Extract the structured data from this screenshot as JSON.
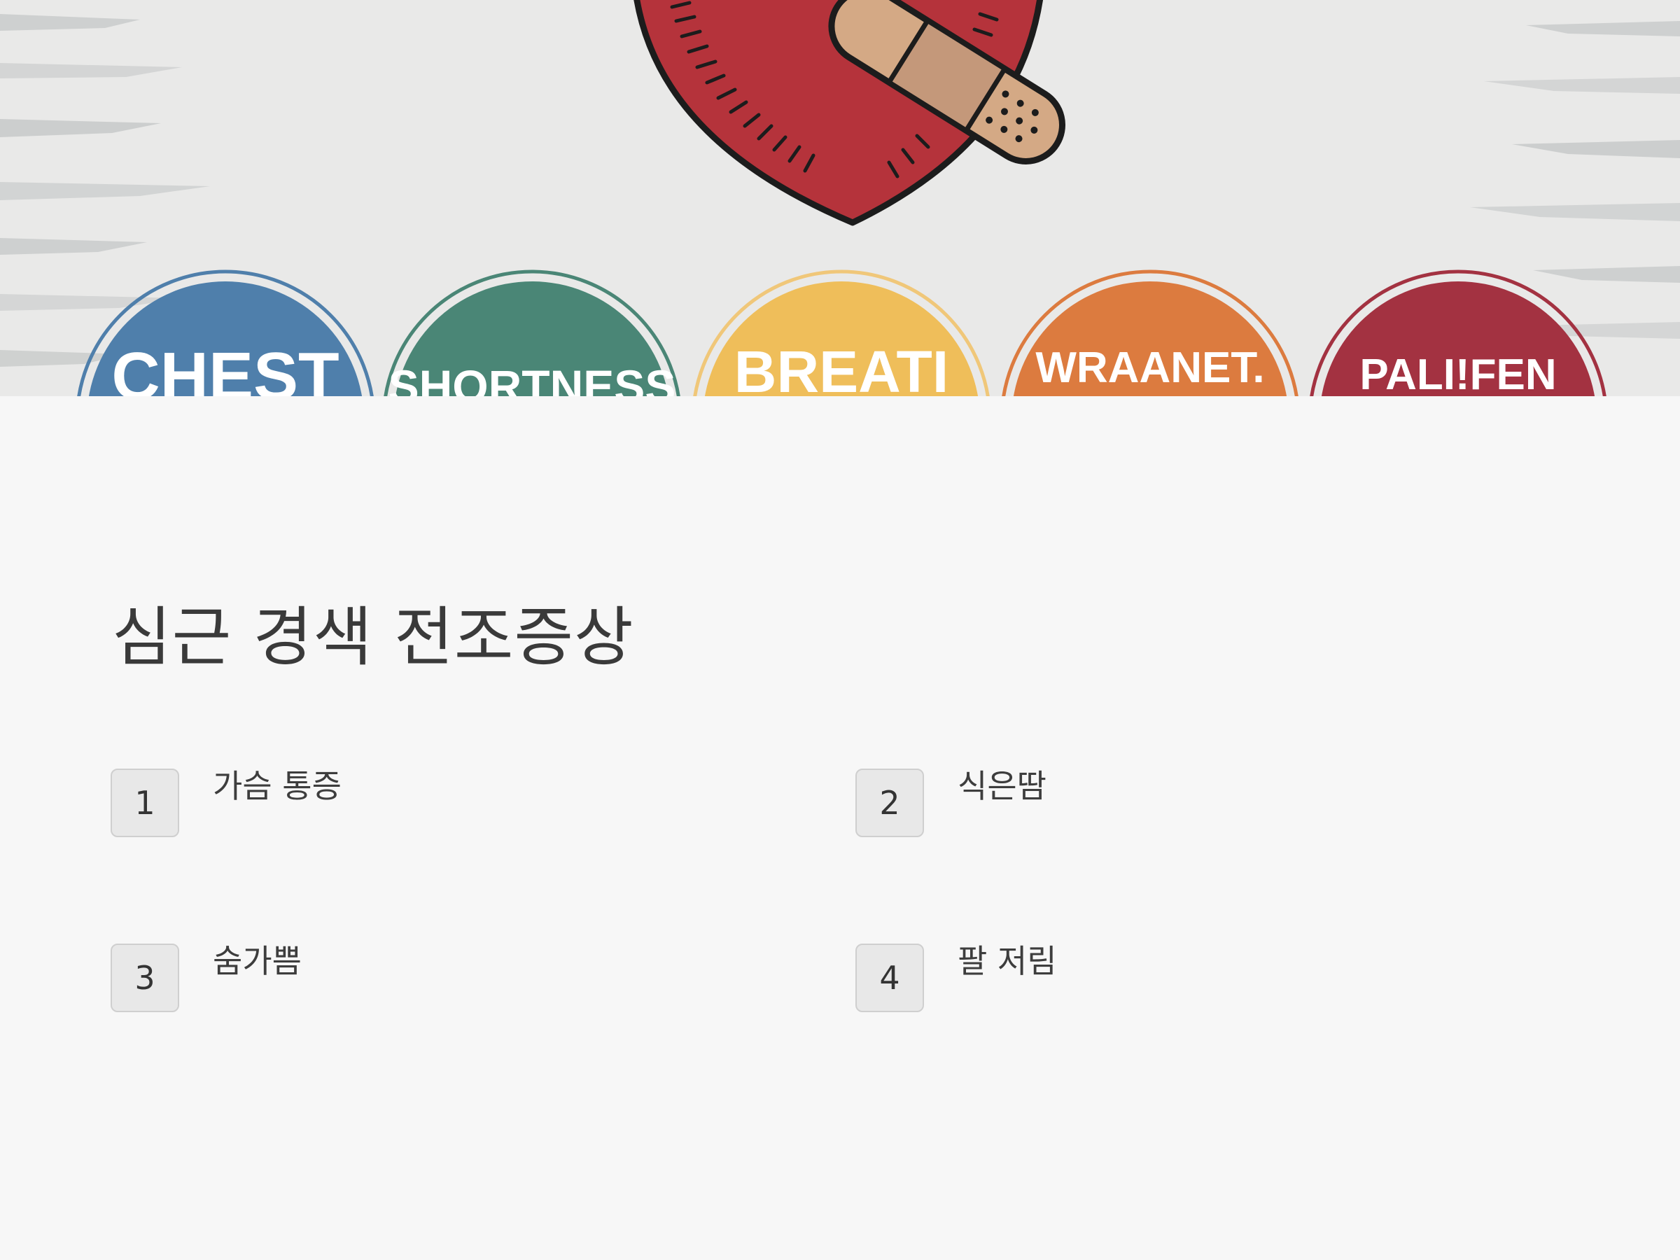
{
  "hero": {
    "badges": [
      {
        "text": "CHEST",
        "color": "#4f7fab",
        "icon": "chest-badge"
      },
      {
        "text": "SHORTNESS",
        "color": "#4a8676",
        "icon": "shortness-badge"
      },
      {
        "text": "BREATI",
        "color": "#efbe5a",
        "icon": "breath-badge"
      },
      {
        "text": "WRAANET.",
        "color": "#dc7b3f",
        "icon": "wraanet-badge"
      },
      {
        "text": "PALI!FEN",
        "color": "#a33241",
        "icon": "palifen-badge"
      }
    ],
    "heart_color": "#b5333b",
    "bandage_color": "#d4a985"
  },
  "title": "심근 경색 전조증상",
  "items": [
    {
      "number": "1",
      "label": "가슴 통증"
    },
    {
      "number": "2",
      "label": "식은땀"
    },
    {
      "number": "3",
      "label": "숨가쁨"
    },
    {
      "number": "4",
      "label": "팔 저림"
    }
  ]
}
